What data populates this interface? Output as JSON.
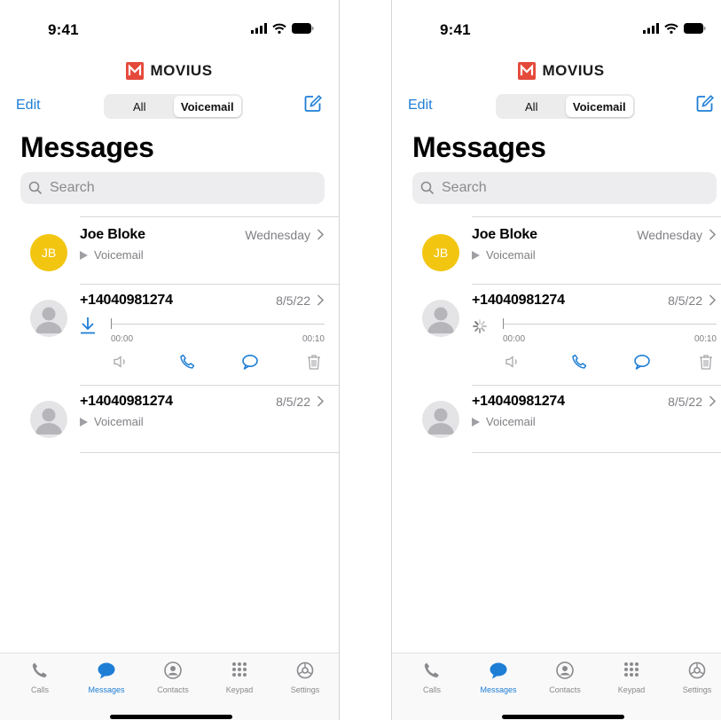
{
  "colors": {
    "accent": "#1e7ed6",
    "brand": "#e5493a",
    "avatar_yellow": "#f2c511"
  },
  "status_bar": {
    "time": "9:41"
  },
  "brand": {
    "name": "MOVIUS"
  },
  "header": {
    "edit_label": "Edit",
    "segments": [
      "All",
      "Voicemail"
    ],
    "selected_segment": "Voicemail",
    "title": "Messages"
  },
  "search": {
    "placeholder": "Search"
  },
  "messages": [
    {
      "initials": "JB",
      "name": "Joe Bloke",
      "date": "Wednesday",
      "subtitle": "Voicemail"
    },
    {
      "initials": "",
      "name": "+14040981274",
      "date": "8/5/22",
      "player": {
        "start_time": "00:00",
        "end_time": "00:10"
      }
    },
    {
      "initials": "",
      "name": "+14040981274",
      "date": "8/5/22",
      "subtitle": "Voicemail"
    }
  ],
  "tabs": [
    {
      "label": "Calls",
      "icon": "phone-icon"
    },
    {
      "label": "Messages",
      "icon": "chat-bubble-icon",
      "active": true
    },
    {
      "label": "Contacts",
      "icon": "contacts-icon"
    },
    {
      "label": "Keypad",
      "icon": "keypad-icon"
    },
    {
      "label": "Settings",
      "icon": "settings-icon"
    }
  ],
  "variants": {
    "left_player_state": "download",
    "right_player_state": "loading"
  }
}
